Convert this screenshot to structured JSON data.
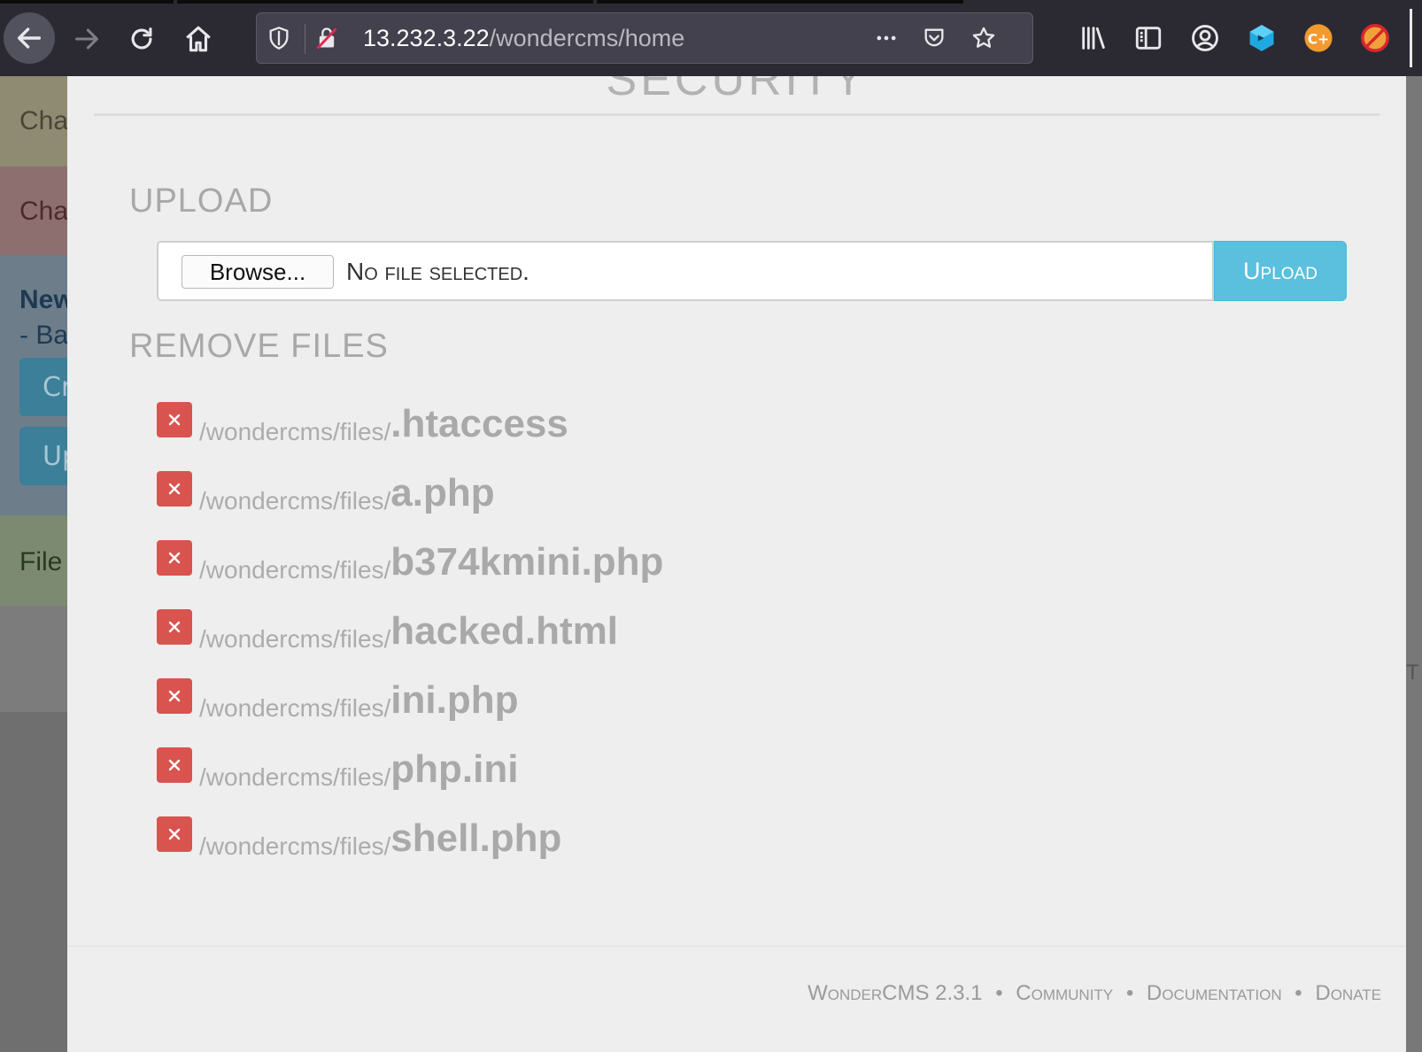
{
  "browser": {
    "url_host": "13.232.3.22",
    "url_path": "/wondercms/home"
  },
  "background_page": {
    "strip1": "Cha",
    "strip2": "Cha",
    "strip3_title": "New",
    "strip3_sub": "- Ba",
    "button1": "Cr",
    "button2": "Up",
    "strip4": "File",
    "right_fragment": "T"
  },
  "modal": {
    "header": "SECURITY",
    "upload_section_title": "UPLOAD",
    "browse_label": "Browse...",
    "file_status": "No file selected.",
    "upload_button": "Upload",
    "remove_section_title": "REMOVE  FILES",
    "files_dir": "/wondercms/files/",
    "files": [
      {
        "name": ".htaccess"
      },
      {
        "name": "a.php"
      },
      {
        "name": "b374kmini.php"
      },
      {
        "name": "hacked.html"
      },
      {
        "name": "ini.php"
      },
      {
        "name": "php.ini"
      },
      {
        "name": "shell.php"
      }
    ],
    "delete_icon": "close-icon"
  },
  "footer": {
    "version": "WonderCMS 2.3.1",
    "separator": "•",
    "community": "Community",
    "documentation": "Documentation",
    "donate": "Donate"
  },
  "colors": {
    "upload_button": "#5bc0de",
    "delete_button": "#d9534f",
    "modal_bg": "#eeeeee"
  }
}
